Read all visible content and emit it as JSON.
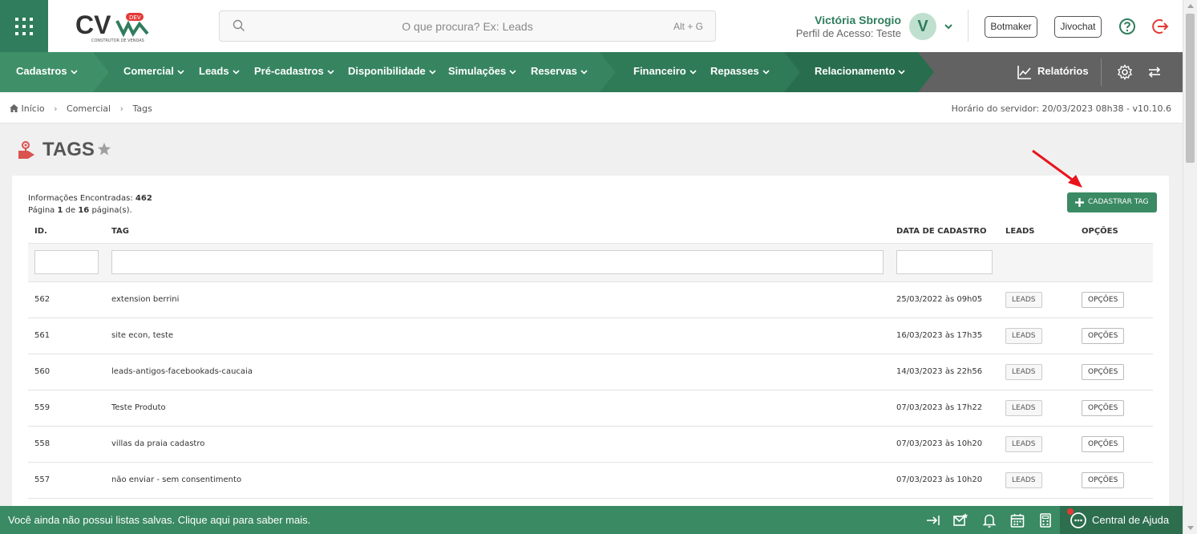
{
  "header": {
    "logo_text": "CV",
    "logo_badge": "DEV",
    "logo_sub": "CONSTRUTOR DE VENDAS",
    "search_placeholder": "O que procura? Ex: Leads",
    "search_shortcut": "Alt + G",
    "user_name": "Victória Sbrogio",
    "user_profile": "Perfil de Acesso: Teste",
    "avatar_letter": "V",
    "botmaker_label": "Botmaker",
    "jivochat_label": "Jivochat"
  },
  "nav": {
    "items": [
      "Cadastros",
      "Comercial",
      "Leads",
      "Pré-cadastros",
      "Disponibilidade",
      "Simulações",
      "Reservas",
      "Financeiro",
      "Repasses",
      "Relacionamento"
    ],
    "reports_label": "Relatórios"
  },
  "breadcrumb": {
    "items": [
      "Início",
      "Comercial",
      "Tags"
    ],
    "server_time": "Horário do servidor: 20/03/2023 08h38 - v10.10.6"
  },
  "page": {
    "title": "TAGS"
  },
  "info": {
    "found_label": "Informações Encontradas:",
    "found_count": "462",
    "page_label": "Página",
    "page_current": "1",
    "page_of": "de",
    "page_total": "16",
    "page_suffix": "página(s)."
  },
  "add_button_label": "CADASTRAR TAG",
  "table": {
    "columns": [
      "ID.",
      "TAG",
      "DATA DE CADASTRO",
      "LEADS",
      "OPÇÕES"
    ],
    "leads_label": "LEADS",
    "options_label": "OPÇÕES",
    "rows": [
      {
        "id": "562",
        "tag": "extension berrini",
        "date": "25/03/2022 às 09h05"
      },
      {
        "id": "561",
        "tag": "site econ, teste",
        "date": "16/03/2023 às 17h35"
      },
      {
        "id": "560",
        "tag": "leads-antigos-facebookads-caucaia",
        "date": "14/03/2023 às 22h56"
      },
      {
        "id": "559",
        "tag": "Teste Produto",
        "date": "07/03/2023 às 17h22"
      },
      {
        "id": "558",
        "tag": "villas da praia cadastro",
        "date": "07/03/2023 às 10h20"
      },
      {
        "id": "557",
        "tag": "não enviar - sem consentimento",
        "date": "07/03/2023 às 10h20"
      }
    ]
  },
  "bottom": {
    "message": "Você ainda não possui listas salvas. Clique aqui para saber mais.",
    "help_center_label": "Central de Ajuda"
  },
  "colors": {
    "brand_green": "#3a8a63",
    "nav_green": "#3c8a63",
    "nav_gray": "#626262",
    "accent_red": "#e53935"
  }
}
